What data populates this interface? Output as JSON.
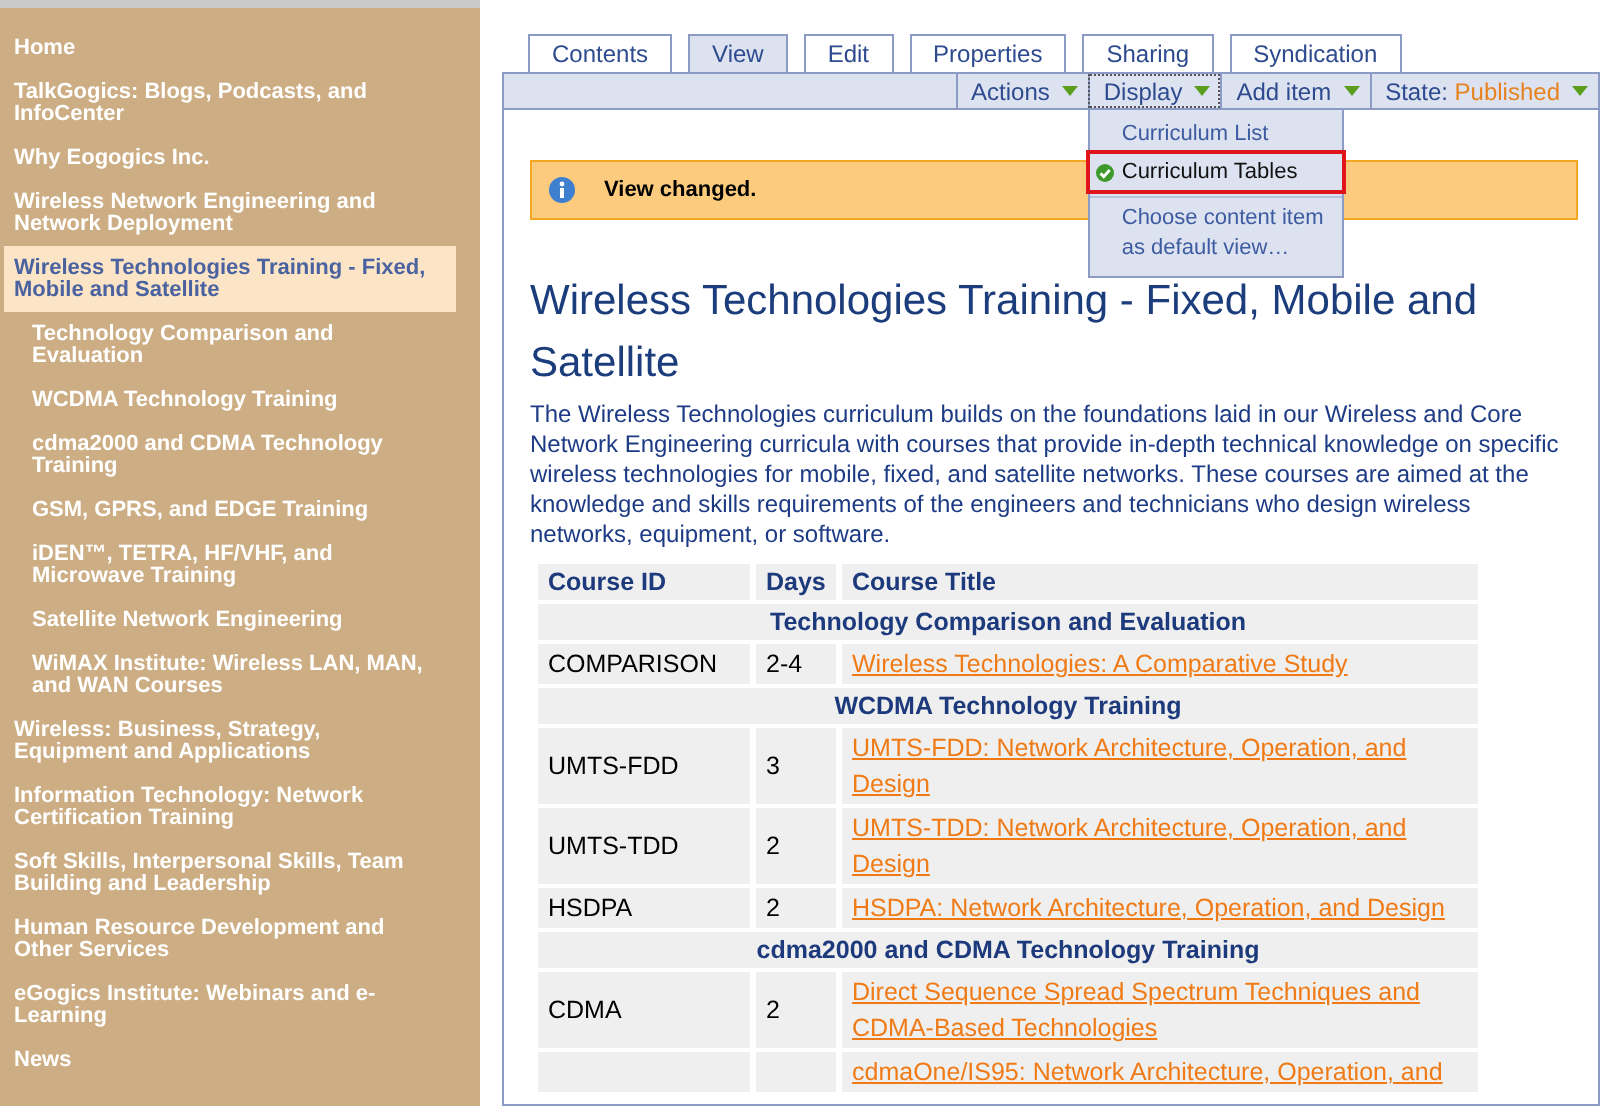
{
  "sidebar": {
    "items": [
      {
        "label": "Home",
        "selected": false
      },
      {
        "label": "TalkGogics: Blogs, Podcasts, and InfoCenter",
        "selected": false
      },
      {
        "label": "Why Eogogics Inc.",
        "selected": false
      },
      {
        "label": "Wireless Network Engineering and Network Deployment",
        "selected": false
      },
      {
        "label": "Wireless Technologies Training - Fixed, Mobile and Satellite",
        "selected": true,
        "children": [
          {
            "label": "Technology Comparison and Evaluation",
            "selected": false
          },
          {
            "label": "WCDMA Technology Training",
            "selected": false
          },
          {
            "label": "cdma2000 and CDMA Technology Training",
            "selected": false
          },
          {
            "label": "GSM, GPRS, and EDGE Training",
            "selected": false
          },
          {
            "label": "iDEN™, TETRA, HF/VHF, and Microwave Training",
            "selected": false
          },
          {
            "label": "Satellite Network Engineering",
            "selected": false
          },
          {
            "label": "WiMAX Institute: Wireless LAN, MAN, and WAN Courses",
            "selected": false
          }
        ]
      },
      {
        "label": "Wireless: Business, Strategy, Equipment and Applications",
        "selected": false
      },
      {
        "label": "Information Technology: Network Certification Training",
        "selected": false
      },
      {
        "label": "Soft Skills, Interpersonal Skills, Team Building and Leadership",
        "selected": false
      },
      {
        "label": "Human Resource Development and Other Services",
        "selected": false
      },
      {
        "label": "eGogics Institute: Webinars and e-Learning",
        "selected": false
      },
      {
        "label": "News",
        "selected": false
      }
    ]
  },
  "tabs": [
    {
      "label": "Contents",
      "selected": false
    },
    {
      "label": "View",
      "selected": true
    },
    {
      "label": "Edit",
      "selected": false
    },
    {
      "label": "Properties",
      "selected": false
    },
    {
      "label": "Sharing",
      "selected": false
    },
    {
      "label": "Syndication",
      "selected": false
    }
  ],
  "toolbar": {
    "menus": [
      {
        "kind": "menu",
        "label": "Actions",
        "open": false
      },
      {
        "kind": "menu",
        "label": "Display",
        "open": true,
        "dropdown": {
          "items": [
            {
              "kind": "option",
              "label": "Curriculum List",
              "checked": false,
              "highlighted": false
            },
            {
              "kind": "option",
              "label": "Curriculum Tables",
              "checked": true,
              "highlighted": true
            },
            {
              "kind": "action",
              "label": "Choose content item as default view…",
              "checked": false,
              "highlighted": false
            }
          ]
        }
      },
      {
        "kind": "menu",
        "label": "Add item",
        "open": false
      },
      {
        "kind": "state",
        "label": "State:",
        "value": "Published",
        "open": false
      }
    ]
  },
  "message": {
    "text": "View changed."
  },
  "page": {
    "title": "Wireless Technologies Training - Fixed, Mobile and Satellite",
    "intro": "The Wireless Technologies curriculum builds on the foundations laid in our Wireless and Core Network Engineering curricula with courses that provide in-depth technical knowledge on specific wireless technologies for mobile, fixed, and satellite networks. These courses are aimed at the knowledge and skills requirements of the engineers and technicians who design wireless networks, equipment, or software."
  },
  "table": {
    "columns": [
      "Course ID",
      "Days",
      "Course Title"
    ],
    "groups": [
      {
        "title": "Technology Comparison and Evaluation",
        "rows": [
          {
            "course_id": "COMPARISON",
            "days": "2-4",
            "title": "Wireless Technologies: A Comparative Study"
          }
        ]
      },
      {
        "title": "WCDMA Technology Training",
        "rows": [
          {
            "course_id": "UMTS-FDD",
            "days": "3",
            "title": "UMTS-FDD: Network Architecture, Operation, and Design"
          },
          {
            "course_id": "UMTS-TDD",
            "days": "2",
            "title": "UMTS-TDD: Network Architecture, Operation, and Design"
          },
          {
            "course_id": "HSDPA",
            "days": "2",
            "title": "HSDPA: Network Architecture, Operation, and Design"
          }
        ]
      },
      {
        "title": "cdma2000 and CDMA Technology Training",
        "rows": [
          {
            "course_id": "CDMA",
            "days": "2",
            "title": "Direct Sequence Spread Spectrum Techniques and CDMA-Based Technologies"
          },
          {
            "title": "cdmaOne/IS95: Network Architecture, Operation, and"
          }
        ]
      }
    ]
  }
}
